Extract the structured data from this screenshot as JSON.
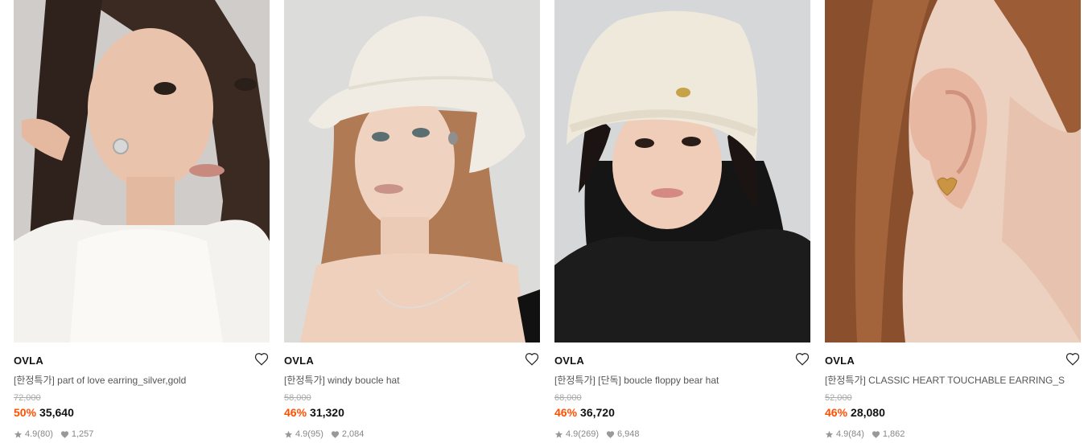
{
  "products": [
    {
      "brand": "OVLA",
      "name": "[한정특가] part of love earring_silver,gold",
      "original_price": "72,000",
      "discount": "50%",
      "price": "35,640",
      "rating": "4.9",
      "review_count": "(80)",
      "likes": "1,257",
      "image_alt": "model wearing silver hoop earring and white fluffy top"
    },
    {
      "brand": "OVLA",
      "name": "[한정특가] windy boucle hat",
      "original_price": "58,000",
      "discount": "46%",
      "price": "31,320",
      "rating": "4.9",
      "review_count": "(95)",
      "likes": "2,084",
      "image_alt": "model wearing ivory boucle bucket hat"
    },
    {
      "brand": "OVLA",
      "name": "[한정특가] [단독] boucle floppy bear hat",
      "original_price": "68,000",
      "discount": "46%",
      "price": "36,720",
      "rating": "4.9",
      "review_count": "(269)",
      "likes": "6,948",
      "image_alt": "model wearing cream boucle floppy hat"
    },
    {
      "brand": "OVLA",
      "name": "[한정특가] CLASSIC HEART TOUCHABLE EARRING_S",
      "original_price": "52,000",
      "discount": "46%",
      "price": "28,080",
      "rating": "4.9",
      "review_count": "(84)",
      "likes": "1,862",
      "image_alt": "close-up of gold heart stud earring"
    }
  ],
  "colors": {
    "discount": "#ff4f00",
    "meta": "#888888",
    "strike": "#aaaaaa"
  },
  "icons": {
    "like": "heart-outline-icon",
    "rating": "star-icon",
    "likes": "heart-filled-icon"
  }
}
